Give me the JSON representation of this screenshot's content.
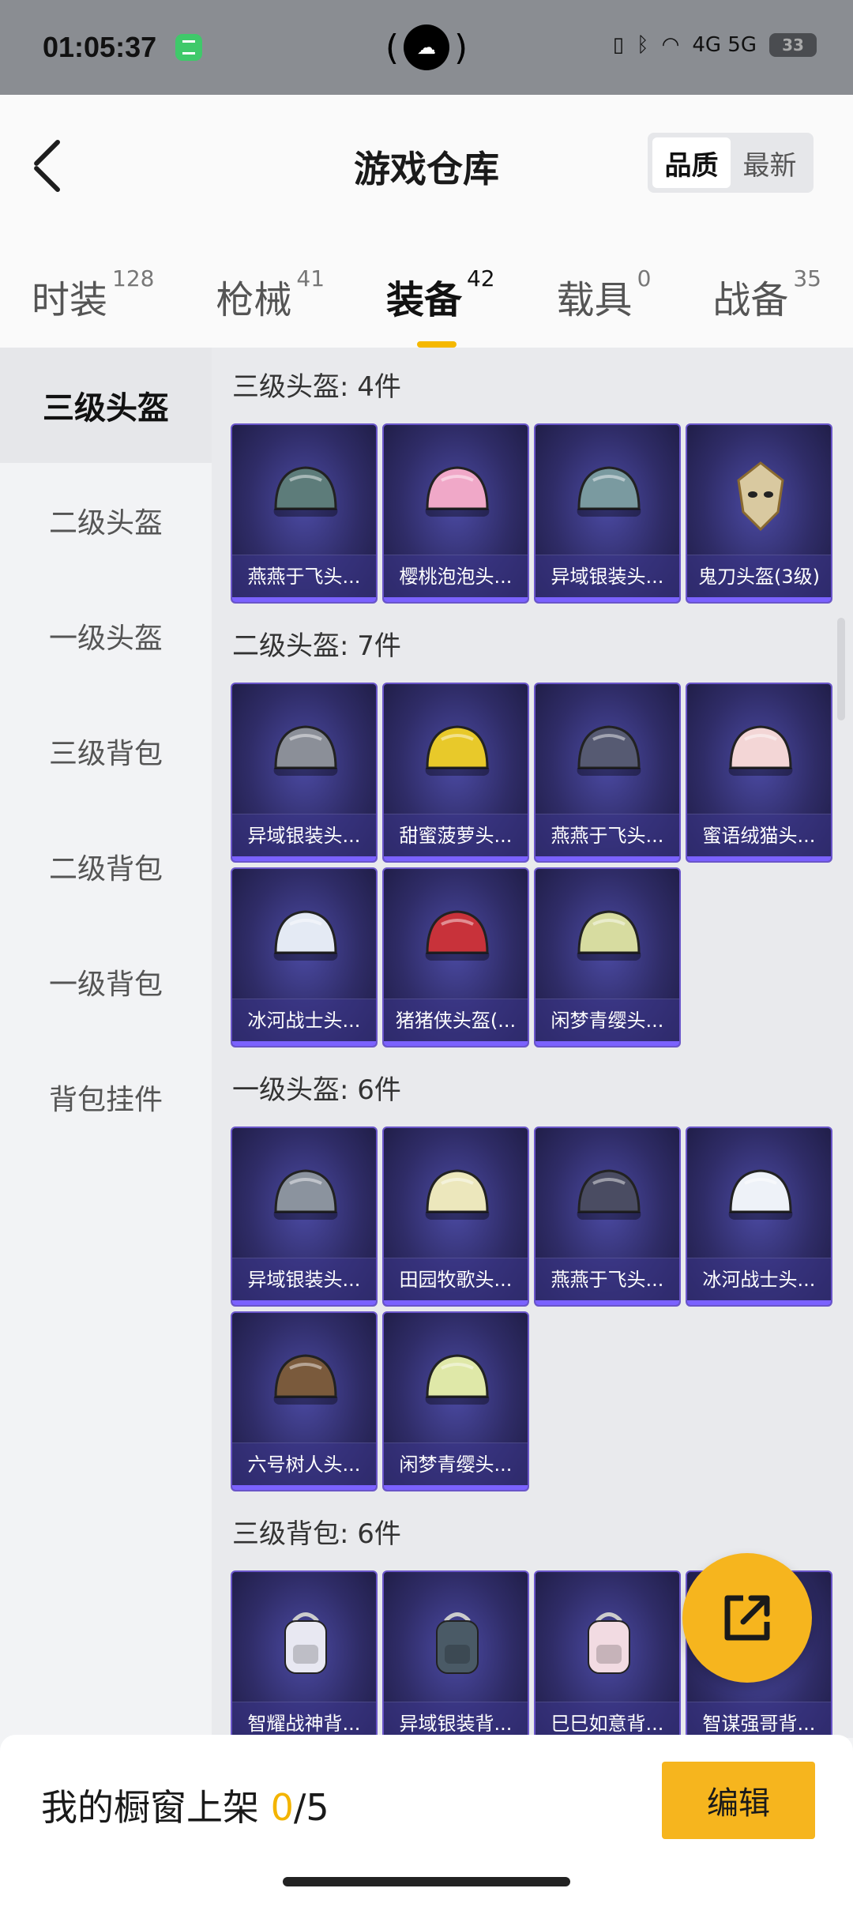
{
  "status_bar": {
    "time": "01:05:37",
    "network": "4G 5G",
    "battery": "33"
  },
  "header": {
    "title": "游戏仓库",
    "sort_options": [
      "品质",
      "最新"
    ],
    "active_sort": "品质"
  },
  "tabs": [
    {
      "label": "时装",
      "count": "128"
    },
    {
      "label": "枪械",
      "count": "41"
    },
    {
      "label": "装备",
      "count": "42"
    },
    {
      "label": "载具",
      "count": "0"
    },
    {
      "label": "战备",
      "count": "35"
    }
  ],
  "active_tab": "装备",
  "sidebar": {
    "items": [
      "三级头盔",
      "二级头盔",
      "一级头盔",
      "三级背包",
      "二级背包",
      "一级背包",
      "背包挂件"
    ],
    "active": "三级头盔"
  },
  "sections": [
    {
      "title": "三级头盔: 4件",
      "items": [
        "燕燕于飞头...",
        "樱桃泡泡头...",
        "异域银装头...",
        "鬼刀头盔(3级)"
      ]
    },
    {
      "title": "二级头盔: 7件",
      "items": [
        "异域银装头...",
        "甜蜜菠萝头...",
        "燕燕于飞头...",
        "蜜语绒猫头...",
        "冰河战士头...",
        "猪猪侠头盔(...",
        "闲梦青缨头..."
      ]
    },
    {
      "title": "一级头盔: 6件",
      "items": [
        "异域银装头...",
        "田园牧歌头...",
        "燕燕于飞头...",
        "冰河战士头...",
        "六号树人头...",
        "闲梦青缨头..."
      ]
    },
    {
      "title": "三级背包: 6件",
      "items": [
        "智耀战神背...",
        "异域银装背...",
        "巳巳如意背...",
        "智谋强哥背..."
      ]
    }
  ],
  "item_icons": [
    [
      "helmet-icon",
      "helmet-icon",
      "helmet-icon",
      "mask-helmet-icon"
    ],
    [
      "helmet-icon",
      "pineapple-helmet-icon",
      "helmet-icon",
      "cat-helmet-icon",
      "helmet-icon",
      "pig-helmet-icon",
      "helmet-icon"
    ],
    [
      "helmet-icon",
      "helmet-icon",
      "helmet-icon",
      "helmet-icon",
      "coconut-helmet-icon",
      "helmet-icon"
    ],
    [
      "backpack-icon",
      "backpack-icon",
      "backpack-icon",
      "backpack-icon"
    ]
  ],
  "item_colors": [
    [
      "#5d7c7a",
      "#f0a8c8",
      "#7a9aa0",
      "#d9c9a0"
    ],
    [
      "#8b8f98",
      "#e8c92a",
      "#565a72",
      "#f3d6d6",
      "#e4eaf4",
      "#c8323a",
      "#d7dca0"
    ],
    [
      "#8b939e",
      "#ece7bc",
      "#4a4c62",
      "#eef2f8",
      "#7a5a3c",
      "#dfe8a8"
    ],
    [
      "#e8e8f2",
      "#4a5a66",
      "#f2dbe2",
      "#d8c080"
    ]
  ],
  "bottom_bar": {
    "label": "我的橱窗上架",
    "current": "0",
    "total": "/5",
    "edit_label": "编辑"
  },
  "colors": {
    "accent": "#f6b51e",
    "card_border": "#6a56c9",
    "card_bg": "#2f2c67"
  }
}
